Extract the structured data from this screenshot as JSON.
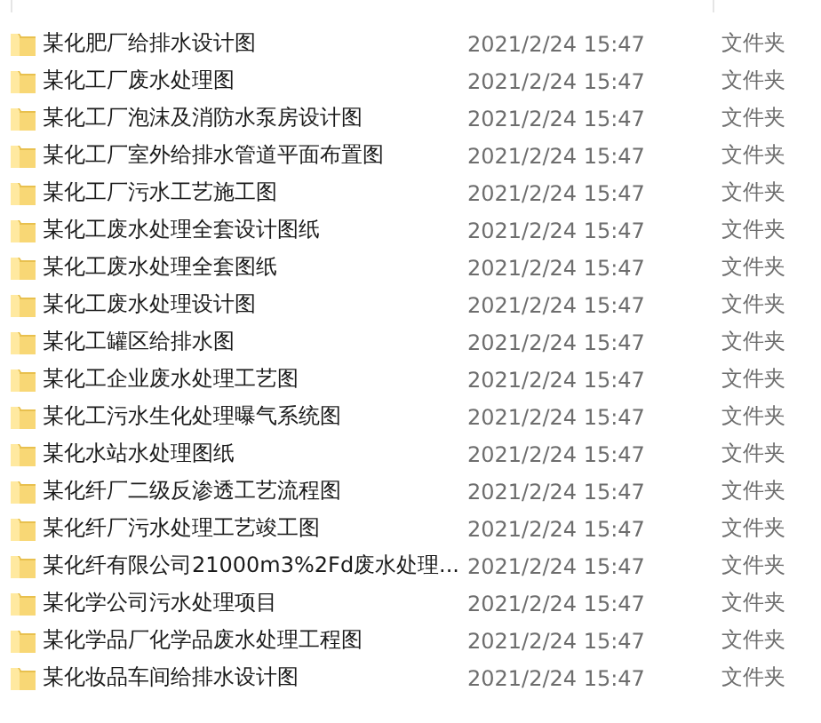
{
  "rows": [
    {
      "name": "某化肥厂给排水设计图",
      "date": "2021/2/24 15:47",
      "type": "文件夹"
    },
    {
      "name": "某化工厂废水处理图",
      "date": "2021/2/24 15:47",
      "type": "文件夹"
    },
    {
      "name": "某化工厂泡沫及消防水泵房设计图",
      "date": "2021/2/24 15:47",
      "type": "文件夹"
    },
    {
      "name": "某化工厂室外给排水管道平面布置图",
      "date": "2021/2/24 15:47",
      "type": "文件夹"
    },
    {
      "name": "某化工厂污水工艺施工图",
      "date": "2021/2/24 15:47",
      "type": "文件夹"
    },
    {
      "name": "某化工废水处理全套设计图纸",
      "date": "2021/2/24 15:47",
      "type": "文件夹"
    },
    {
      "name": "某化工废水处理全套图纸",
      "date": "2021/2/24 15:47",
      "type": "文件夹"
    },
    {
      "name": "某化工废水处理设计图",
      "date": "2021/2/24 15:47",
      "type": "文件夹"
    },
    {
      "name": "某化工罐区给排水图",
      "date": "2021/2/24 15:47",
      "type": "文件夹"
    },
    {
      "name": "某化工企业废水处理工艺图",
      "date": "2021/2/24 15:47",
      "type": "文件夹"
    },
    {
      "name": "某化工污水生化处理曝气系统图",
      "date": "2021/2/24 15:47",
      "type": "文件夹"
    },
    {
      "name": "某化水站水处理图纸",
      "date": "2021/2/24 15:47",
      "type": "文件夹"
    },
    {
      "name": "某化纤厂二级反渗透工艺流程图",
      "date": "2021/2/24 15:47",
      "type": "文件夹"
    },
    {
      "name": "某化纤厂污水处理工艺竣工图",
      "date": "2021/2/24 15:47",
      "type": "文件夹"
    },
    {
      "name": "某化纤有限公司21000m3%2Fd废水处理...",
      "date": "2021/2/24 15:47",
      "type": "文件夹"
    },
    {
      "name": "某化学公司污水处理项目",
      "date": "2021/2/24 15:47",
      "type": "文件夹"
    },
    {
      "name": "某化学品厂化学品废水处理工程图",
      "date": "2021/2/24 15:47",
      "type": "文件夹"
    },
    {
      "name": "某化妆品车间给排水设计图",
      "date": "2021/2/24 15:47",
      "type": "文件夹"
    }
  ]
}
